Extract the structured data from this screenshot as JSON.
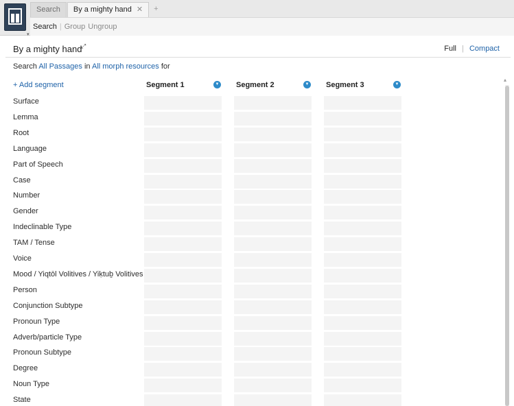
{
  "tabs": [
    {
      "label": "Search"
    },
    {
      "label": "By a mighty hand",
      "close": "✕"
    },
    {
      "label": "+"
    }
  ],
  "toolbar": {
    "search": "Search",
    "group": "Group",
    "ungroup": "Ungroup"
  },
  "document": {
    "title": "By a mighty hand",
    "view_full": "Full",
    "view_compact": "Compact"
  },
  "search_line": {
    "prefix": "Search",
    "passages": "All Passages",
    "in": "in",
    "resources": "All morph resources",
    "suffix": "for"
  },
  "add_segment": "+ Add segment",
  "segments": [
    "Segment 1",
    "Segment 2",
    "Segment 3"
  ],
  "rows": [
    "Surface",
    "Lemma",
    "Root",
    "Language",
    "Part of Speech",
    "Case",
    "Number",
    "Gender",
    "Indeclinable Type",
    "TAM / Tense",
    "Voice",
    "Mood / Yiqtōl Volitives / Yiḳtuḇ Volitives",
    "Person",
    "Conjunction Subtype",
    "Pronoun Type",
    "Adverb/particle Type",
    "Pronoun Subtype",
    "Degree",
    "Noun Type",
    "State"
  ],
  "icons": {
    "app": "app-logo-icon",
    "pin": "pin-icon",
    "dropdown": "chevron-down-icon"
  },
  "colors": {
    "link": "#1e62a8",
    "accent": "#2e8bc9",
    "app_icon": "#2f4258"
  }
}
